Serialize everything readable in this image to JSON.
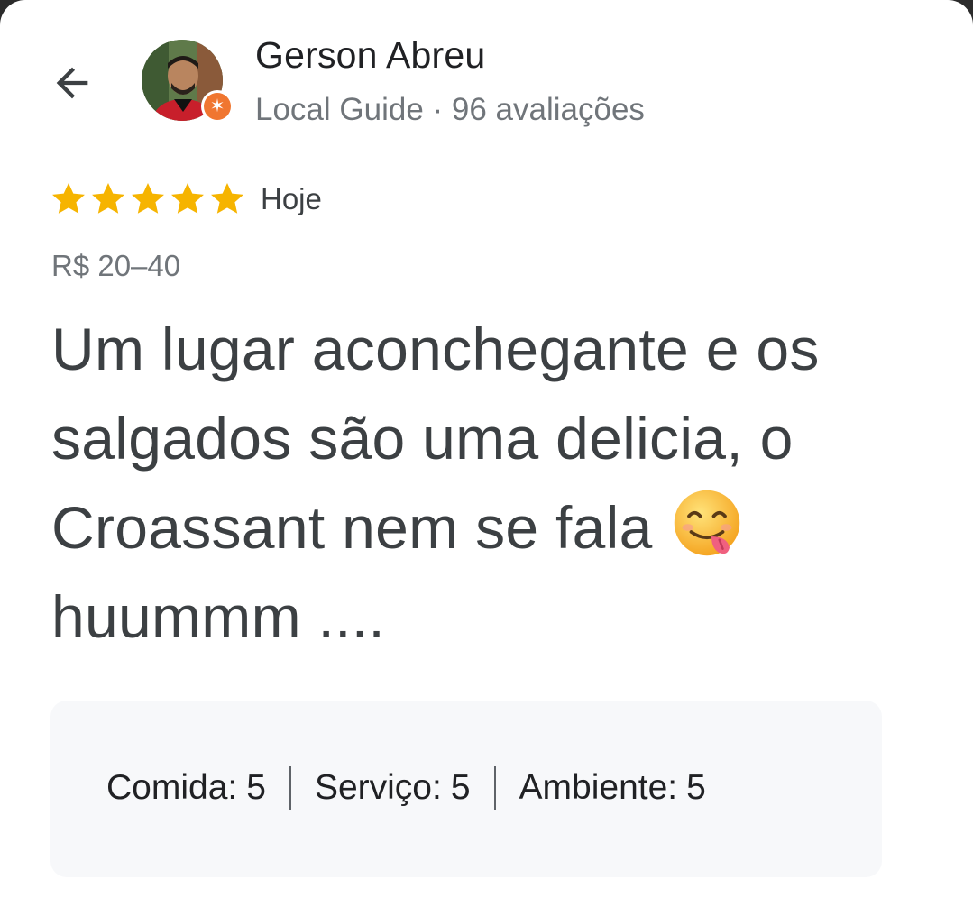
{
  "reviewer": {
    "name": "Gerson Abreu",
    "meta": "Local Guide · 96 avaliações"
  },
  "review": {
    "rating": 5,
    "rating_max": 5,
    "date": "Hoje",
    "price": "R$ 20–40",
    "text": "Um lugar aconchegante e os salgados são uma delicia, o Croassant nem se fala",
    "text_tail": "huummm ...."
  },
  "ratings": [
    {
      "label": "Comida:",
      "value": "5"
    },
    {
      "label": "Serviço:",
      "value": "5"
    },
    {
      "label": "Ambiente:",
      "value": "5"
    }
  ],
  "icons": {
    "back": "arrow-back-icon",
    "badge": "local-guide-star-icon",
    "star": "star-icon",
    "emoji": "face-savoring-food-emoji"
  },
  "colors": {
    "star": "#F6B400",
    "badge": "#F07630",
    "card_bg": "#F7F8FA",
    "text_primary": "#202124",
    "text_secondary": "#70757A"
  }
}
